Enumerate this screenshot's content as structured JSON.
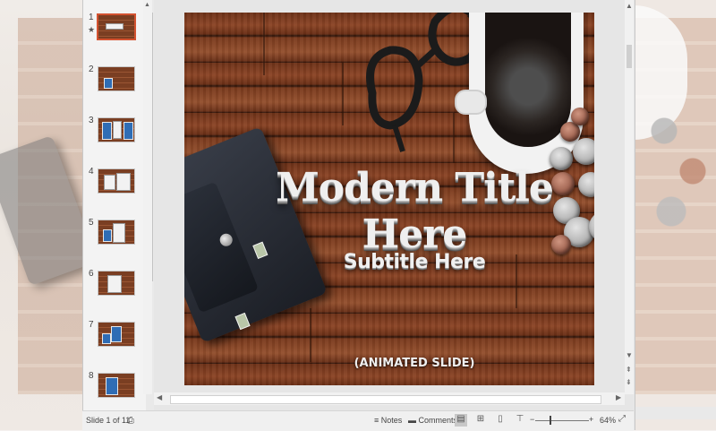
{
  "thumbnails": [
    {
      "num": "1",
      "starred": true,
      "active": true
    },
    {
      "num": "2",
      "starred": false,
      "active": false
    },
    {
      "num": "3",
      "starred": false,
      "active": false
    },
    {
      "num": "4",
      "starred": false,
      "active": false
    },
    {
      "num": "5",
      "starred": false,
      "active": false
    },
    {
      "num": "6",
      "starred": false,
      "active": false
    },
    {
      "num": "7",
      "starred": false,
      "active": false
    },
    {
      "num": "8",
      "starred": false,
      "active": false
    }
  ],
  "thumb_star_glyph": "★",
  "slide": {
    "title": "Modern Title Here",
    "subtitle": "Subtitle Here",
    "footer_label": "(ANIMATED SLIDE)"
  },
  "statusbar": {
    "slide_indicator": "Slide 1 of 11",
    "notes_label": "Notes",
    "comments_label": "Comments",
    "zoom_minus": "−",
    "zoom_plus": "+",
    "zoom_level": "64%"
  },
  "icons": {
    "spell_check": "spellcheck-icon",
    "notes": "notes-icon",
    "comments": "comment-icon",
    "normal_view": "normal-view-icon",
    "slide_sorter": "slide-sorter-icon",
    "reading_view": "reading-view-icon",
    "slideshow": "slideshow-icon",
    "fit_window": "fit-to-window-icon"
  },
  "colors": {
    "accent": "#d35230",
    "wood": "#8c4526"
  }
}
